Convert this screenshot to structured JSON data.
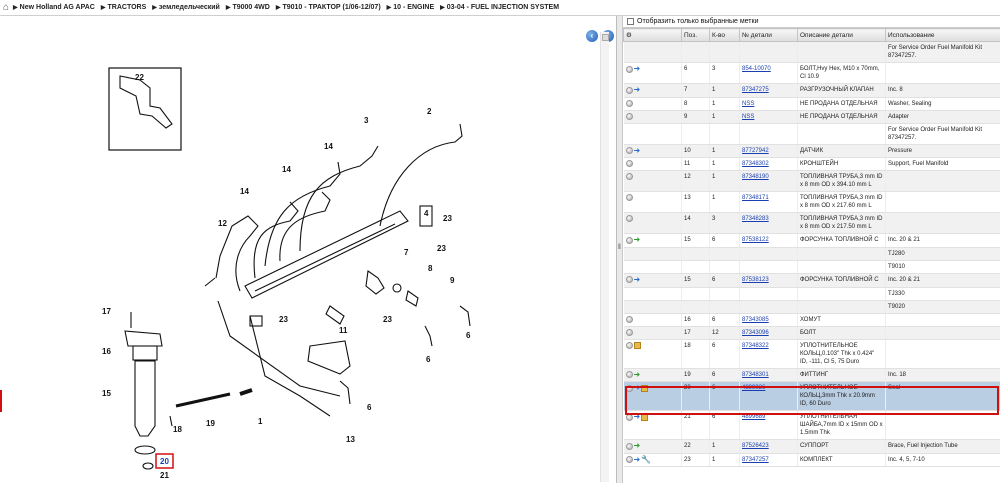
{
  "breadcrumb": [
    "New Holland AG APAC",
    "TRACTORS",
    "земледельческий",
    "T9000 4WD",
    "T9010 - ТРАКТОР (1/06-12/07)",
    "10 - ENGINE",
    "03-04 - FUEL INJECTION SYSTEM"
  ],
  "filter_label": "Отобразить только выбранные метки",
  "columns": [
    "Поз.",
    "К-во",
    "№ детали",
    "Описание детали",
    "Использование"
  ],
  "callouts": [
    "22",
    "2",
    "3",
    "14",
    "14",
    "14",
    "4",
    "23",
    "12",
    "7",
    "23",
    "8",
    "9",
    "6",
    "23",
    "11",
    "23",
    "17",
    "16",
    "15",
    "6",
    "18",
    "19",
    "1",
    "6",
    "13",
    "20",
    "21"
  ],
  "rows": [
    {
      "pos": "",
      "qty": "",
      "part": "",
      "desc": "",
      "use": "For Service Order Fuel Manifold Kit 87347257.",
      "icons": [],
      "alt": true
    },
    {
      "pos": "6",
      "qty": "3",
      "part": "854-10070",
      "desc": "БОЛТ,Hvy Hex, M10 x 70mm, Cl 10.9",
      "use": "",
      "icons": [
        "circ",
        "blue"
      ],
      "alt": false
    },
    {
      "pos": "7",
      "qty": "1",
      "part": "87347275",
      "desc": "РАЗГРУЗОЧНЫЙ КЛАПАН",
      "use": "Inc. 8",
      "icons": [
        "circ",
        "blue"
      ],
      "alt": true
    },
    {
      "pos": "8",
      "qty": "1",
      "part": "NSS",
      "desc": "НЕ ПРОДАНА ОТДЕЛЬНАЯ",
      "use": "Washer, Sealing",
      "icons": [
        "circ"
      ],
      "alt": false
    },
    {
      "pos": "9",
      "qty": "1",
      "part": "NSS",
      "desc": "НЕ ПРОДАНА ОТДЕЛЬНАЯ",
      "use": "Adapter",
      "icons": [
        "circ"
      ],
      "alt": true
    },
    {
      "pos": "",
      "qty": "",
      "part": "",
      "desc": "",
      "use": "For Service Order Fuel Manifold Kit 87347257.",
      "icons": [],
      "alt": false
    },
    {
      "pos": "10",
      "qty": "1",
      "part": "87727942",
      "desc": "ДАТЧИК",
      "use": "Pressure",
      "icons": [
        "circ",
        "blue"
      ],
      "alt": true
    },
    {
      "pos": "11",
      "qty": "1",
      "part": "87348302",
      "desc": "КРОНШТЕЙН",
      "use": "Support, Fuel Manifold",
      "icons": [
        "circ"
      ],
      "alt": false
    },
    {
      "pos": "12",
      "qty": "1",
      "part": "87348190",
      "desc": "ТОПЛИВНАЯ ТРУБА,3 mm ID x 8 mm OD x 394.10 mm L",
      "use": "",
      "icons": [
        "circ"
      ],
      "alt": true
    },
    {
      "pos": "13",
      "qty": "1",
      "part": "87348171",
      "desc": "ТОПЛИВНАЯ ТРУБА,3 mm ID x 8 mm OD x 217.60 mm L",
      "use": "",
      "icons": [
        "circ"
      ],
      "alt": false
    },
    {
      "pos": "14",
      "qty": "3",
      "part": "87348283",
      "desc": "ТОПЛИВНАЯ ТРУБА,3 mm ID x 8 mm OD x 217.50 mm L",
      "use": "",
      "icons": [
        "circ"
      ],
      "alt": true
    },
    {
      "pos": "15",
      "qty": "6",
      "part": "87538122",
      "desc": "ФОРСУНКА ТОПЛИВНОЙ С",
      "use": "Inc. 20 & 21",
      "icons": [
        "circ",
        "green"
      ],
      "alt": false
    },
    {
      "pos": "",
      "qty": "",
      "part": "",
      "desc": "",
      "use": "TJ280",
      "icons": [],
      "alt": true
    },
    {
      "pos": "",
      "qty": "",
      "part": "",
      "desc": "",
      "use": "T9010",
      "icons": [],
      "alt": false
    },
    {
      "pos": "15",
      "qty": "6",
      "part": "87538123",
      "desc": "ФОРСУНКА ТОПЛИВНОЙ С",
      "use": "Inc. 20 & 21",
      "icons": [
        "circ",
        "blue"
      ],
      "alt": true
    },
    {
      "pos": "",
      "qty": "",
      "part": "",
      "desc": "",
      "use": "TJ330",
      "icons": [],
      "alt": false
    },
    {
      "pos": "",
      "qty": "",
      "part": "",
      "desc": "",
      "use": "T9020",
      "icons": [],
      "alt": true
    },
    {
      "pos": "16",
      "qty": "6",
      "part": "87343085",
      "desc": "ХОМУТ",
      "use": "",
      "icons": [
        "circ"
      ],
      "alt": false
    },
    {
      "pos": "17",
      "qty": "12",
      "part": "87343096",
      "desc": "БОЛТ",
      "use": "",
      "icons": [
        "circ"
      ],
      "alt": true
    },
    {
      "pos": "18",
      "qty": "6",
      "part": "87348322",
      "desc": "УПЛОТНИТЕЛЬНОЕ КОЛЬЦ,0.103\" Thk x 0.424\" ID, -111, Cl 5, 75 Duro",
      "use": "",
      "icons": [
        "circ",
        "box"
      ],
      "alt": false
    },
    {
      "pos": "19",
      "qty": "6",
      "part": "87348301",
      "desc": "ФИТТИНГ",
      "use": "Inc. 18",
      "icons": [
        "circ",
        "green"
      ],
      "alt": true
    },
    {
      "pos": "20",
      "qty": "6",
      "part": "4899926",
      "desc": "УПЛОТНИТЕЛЬНОЕ КОЛЬЦ,3mm Thk x 20.9mm ID, 60 Duro",
      "use": "Seal",
      "icons": [
        "circ",
        "blue",
        "box"
      ],
      "alt": false,
      "sel": true
    },
    {
      "pos": "21",
      "qty": "6",
      "part": "4899689",
      "desc": "УПЛОТНИТЕЛЬНАЯ ШАЙБА,7mm ID x 15mm OD x 1.5mm Thk",
      "use": "",
      "icons": [
        "circ",
        "blue",
        "box"
      ],
      "alt": false
    },
    {
      "pos": "22",
      "qty": "1",
      "part": "87526423",
      "desc": "СУППОРТ",
      "use": "Brace, Fuel Injection Tube",
      "icons": [
        "circ",
        "green"
      ],
      "alt": true
    },
    {
      "pos": "23",
      "qty": "1",
      "part": "87347257",
      "desc": "КОМПЛЕКТ",
      "use": "Inc. 4, 5, 7-10",
      "icons": [
        "circ",
        "blue",
        "wrench"
      ],
      "alt": false
    }
  ]
}
